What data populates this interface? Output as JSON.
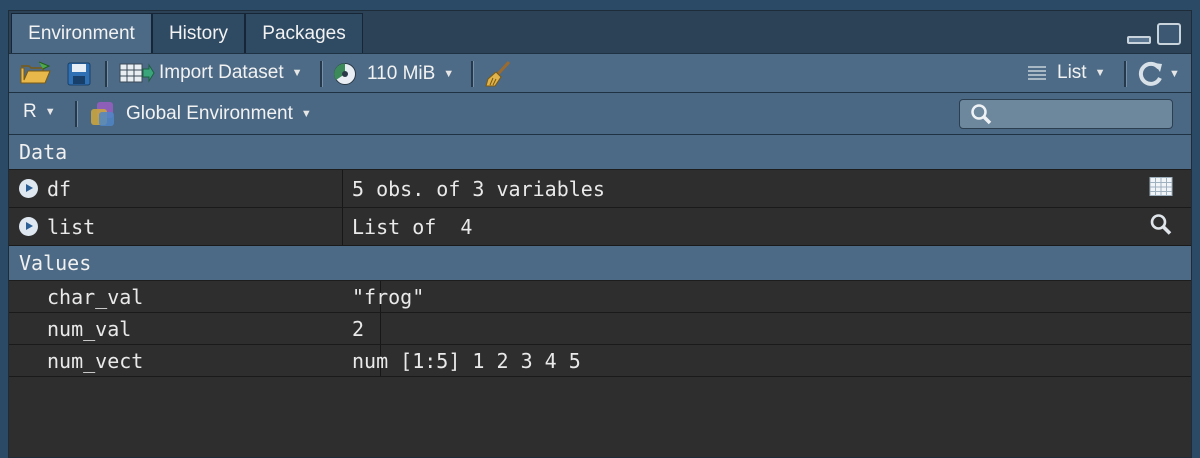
{
  "tabs": [
    {
      "label": "Environment",
      "active": true
    },
    {
      "label": "History",
      "active": false
    },
    {
      "label": "Packages",
      "active": false
    }
  ],
  "toolbar": {
    "open_icon": "open-folder-icon",
    "save_icon": "save-icon",
    "import_label": "Import Dataset",
    "memory_label": "110 MiB",
    "broom_icon": "broom-icon",
    "view_mode_label": "List",
    "refresh_icon": "refresh-icon"
  },
  "env_bar": {
    "language_label": "R",
    "environment_label": "Global Environment",
    "search_placeholder": ""
  },
  "sections": {
    "data_header": "Data",
    "values_header": "Values"
  },
  "data_rows": [
    {
      "name": "df",
      "value": "5 obs. of 3 variables",
      "icon": "grid-view-icon"
    },
    {
      "name": "list",
      "value": "List of  4",
      "icon": "magnifier-icon"
    }
  ],
  "value_rows": [
    {
      "name": "char_val",
      "value": "\"frog\""
    },
    {
      "name": "num_val",
      "value": "2"
    },
    {
      "name": "num_vect",
      "value": "num [1:5] 1 2 3 4 5"
    }
  ],
  "colors": {
    "toolbar_bg": "#4d6b86",
    "pane_bg": "#2e2e2e",
    "accent": "#2c5f95"
  }
}
